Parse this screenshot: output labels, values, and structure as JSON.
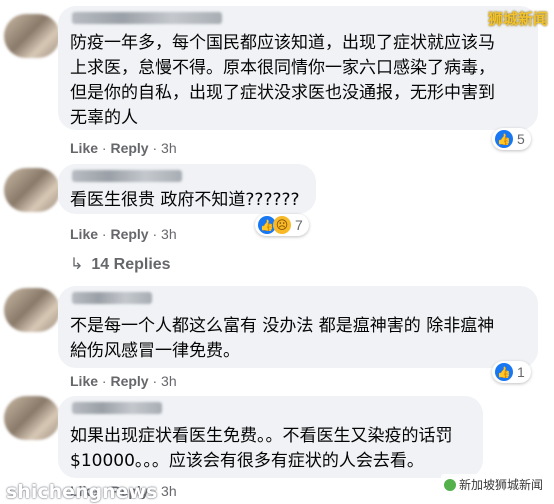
{
  "watermarks": {
    "top": "狮城新闻",
    "bottom_left": "shichengnews",
    "bottom_right": "新加坡狮城新闻"
  },
  "comments": [
    {
      "text_lines": [
        "防疫一年多，每个国民都应该知道，出现了症状就应该马",
        "上求医，怠慢不得。原本很同情你一家六口感染了病毒，",
        "但是你的自私，出现了症状没求医也没通报，无形中害到",
        "无辜的人"
      ],
      "actions": {
        "like": "Like",
        "reply": "Reply",
        "time": "3h"
      },
      "reactions": {
        "count": "5",
        "types": [
          "like"
        ]
      }
    },
    {
      "text_lines": [
        "看医生很贵 政府不知道??????"
      ],
      "actions": {
        "like": "Like",
        "reply": "Reply",
        "time": "3h"
      },
      "reactions": {
        "count": "7",
        "types": [
          "like",
          "sad"
        ]
      },
      "replies_label": "14 Replies"
    },
    {
      "text_lines": [
        "不是每一个人都这么富有 没办法 都是瘟神害的 除非瘟神",
        "給伤风感冒一律免费。"
      ],
      "actions": {
        "like": "Like",
        "reply": "Reply",
        "time": "3h"
      },
      "reactions": {
        "count": "1",
        "types": [
          "like"
        ]
      }
    },
    {
      "text_lines": [
        "如果出现症状看医生免费。。不看医生又染疫的话罚",
        "$10000。。。应该会有很多有症状的人会去看。"
      ],
      "actions": {
        "like": "Like",
        "reply": "Reply",
        "time": "3h"
      },
      "reactions": {
        "count": "",
        "types": []
      }
    }
  ],
  "icons": {
    "like": "thumbs-up-icon",
    "sad": "sad-face-icon",
    "reply_arrow": "reply-arrow-icon"
  },
  "colors": {
    "bubble": "#f0f2f5",
    "meta": "#65676b",
    "text": "#050505",
    "like_blue": "#1877f2",
    "sad_yellow": "#f7b928"
  }
}
